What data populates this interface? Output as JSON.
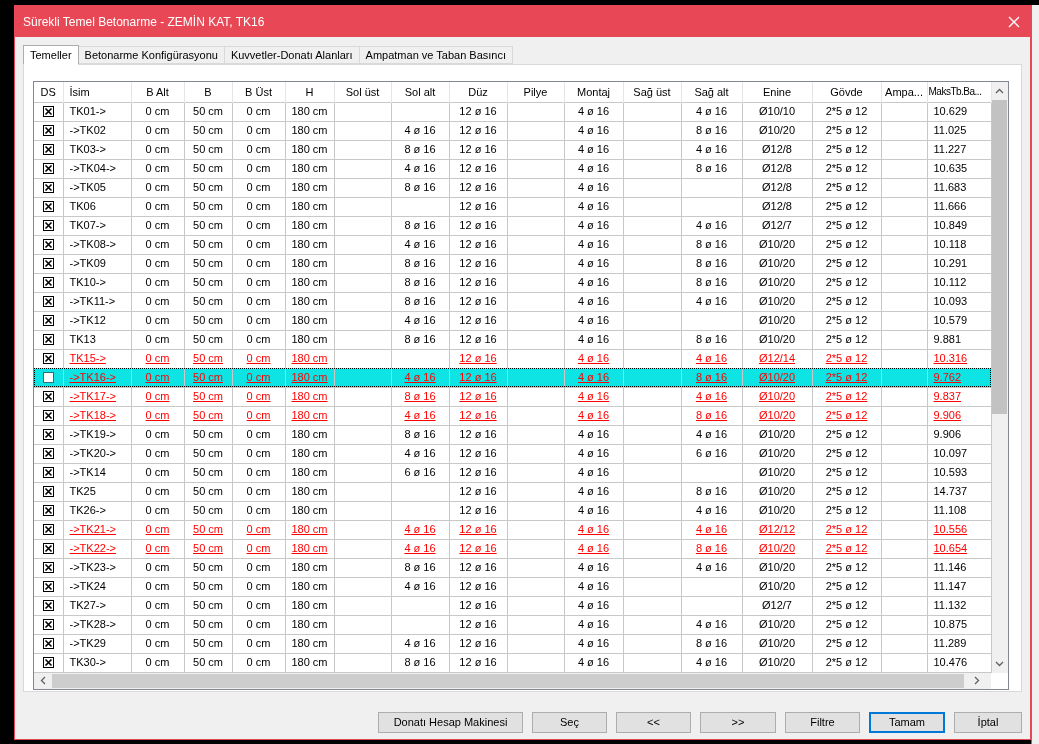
{
  "window": {
    "title": "Sürekli Temel Betonarme - ZEMİN KAT, TK16"
  },
  "tabs": [
    {
      "label": "Temeller",
      "selected": true
    },
    {
      "label": "Betonarme Konfigürasyonu",
      "selected": false
    },
    {
      "label": "Kuvvetler-Donatı Alanları",
      "selected": false
    },
    {
      "label": "Ampatman ve Taban Basıncı",
      "selected": false
    }
  ],
  "table": {
    "checkbox_column": "DS",
    "columns": [
      "İsim",
      "B Alt",
      "B",
      "B Üst",
      "H",
      "Sol üst",
      "Sol alt",
      "Düz",
      "Pilye",
      "Montaj",
      "Sağ üst",
      "Sağ alt",
      "Enine",
      "Gövde",
      "Ampa...",
      "MaksTb.Ba..."
    ],
    "rows": [
      {
        "checked": true,
        "flagged": false,
        "selected": false,
        "cells": [
          "TK01->",
          "0 cm",
          "50 cm",
          "0 cm",
          "180 cm",
          null,
          null,
          "12 ø 16",
          null,
          "4 ø 16",
          null,
          "4 ø 16",
          "Ø10/10",
          "2*5 ø 12",
          null,
          "10.629"
        ]
      },
      {
        "checked": true,
        "flagged": false,
        "selected": false,
        "cells": [
          "->TK02",
          "0 cm",
          "50 cm",
          "0 cm",
          "180 cm",
          null,
          "4 ø 16",
          "12 ø 16",
          null,
          "4 ø 16",
          null,
          "8 ø 16",
          "Ø10/20",
          "2*5 ø 12",
          null,
          "11.025"
        ]
      },
      {
        "checked": true,
        "flagged": false,
        "selected": false,
        "cells": [
          "TK03->",
          "0 cm",
          "50 cm",
          "0 cm",
          "180 cm",
          null,
          "8 ø 16",
          "12 ø 16",
          null,
          "4 ø 16",
          null,
          "4 ø 16",
          "Ø12/8",
          "2*5 ø 12",
          null,
          "11.227"
        ]
      },
      {
        "checked": true,
        "flagged": false,
        "selected": false,
        "cells": [
          "->TK04->",
          "0 cm",
          "50 cm",
          "0 cm",
          "180 cm",
          null,
          "4 ø 16",
          "12 ø 16",
          null,
          "4 ø 16",
          null,
          "8 ø 16",
          "Ø12/8",
          "2*5 ø 12",
          null,
          "10.635"
        ]
      },
      {
        "checked": true,
        "flagged": false,
        "selected": false,
        "cells": [
          "->TK05",
          "0 cm",
          "50 cm",
          "0 cm",
          "180 cm",
          null,
          "8 ø 16",
          "12 ø 16",
          null,
          "4 ø 16",
          null,
          null,
          "Ø12/8",
          "2*5 ø 12",
          null,
          "11.683"
        ]
      },
      {
        "checked": true,
        "flagged": false,
        "selected": false,
        "cells": [
          "TK06",
          "0 cm",
          "50 cm",
          "0 cm",
          "180 cm",
          null,
          null,
          "12 ø 16",
          null,
          "4 ø 16",
          null,
          null,
          "Ø12/8",
          "2*5 ø 12",
          null,
          "11.666"
        ]
      },
      {
        "checked": true,
        "flagged": false,
        "selected": false,
        "cells": [
          "TK07->",
          "0 cm",
          "50 cm",
          "0 cm",
          "180 cm",
          null,
          "8 ø 16",
          "12 ø 16",
          null,
          "4 ø 16",
          null,
          "4 ø 16",
          "Ø12/7",
          "2*5 ø 12",
          null,
          "10.849"
        ]
      },
      {
        "checked": true,
        "flagged": false,
        "selected": false,
        "cells": [
          "->TK08->",
          "0 cm",
          "50 cm",
          "0 cm",
          "180 cm",
          null,
          "4 ø 16",
          "12 ø 16",
          null,
          "4 ø 16",
          null,
          "8 ø 16",
          "Ø10/20",
          "2*5 ø 12",
          null,
          "10.118"
        ]
      },
      {
        "checked": true,
        "flagged": false,
        "selected": false,
        "cells": [
          "->TK09",
          "0 cm",
          "50 cm",
          "0 cm",
          "180 cm",
          null,
          "8 ø 16",
          "12 ø 16",
          null,
          "4 ø 16",
          null,
          "8 ø 16",
          "Ø10/20",
          "2*5 ø 12",
          null,
          "10.291"
        ]
      },
      {
        "checked": true,
        "flagged": false,
        "selected": false,
        "cells": [
          "TK10->",
          "0 cm",
          "50 cm",
          "0 cm",
          "180 cm",
          null,
          "8 ø 16",
          "12 ø 16",
          null,
          "4 ø 16",
          null,
          "8 ø 16",
          "Ø10/20",
          "2*5 ø 12",
          null,
          "10.112"
        ]
      },
      {
        "checked": true,
        "flagged": false,
        "selected": false,
        "cells": [
          "->TK11->",
          "0 cm",
          "50 cm",
          "0 cm",
          "180 cm",
          null,
          "8 ø 16",
          "12 ø 16",
          null,
          "4 ø 16",
          null,
          "4 ø 16",
          "Ø10/20",
          "2*5 ø 12",
          null,
          "10.093"
        ]
      },
      {
        "checked": true,
        "flagged": false,
        "selected": false,
        "cells": [
          "->TK12",
          "0 cm",
          "50 cm",
          "0 cm",
          "180 cm",
          null,
          "4 ø 16",
          "12 ø 16",
          null,
          "4 ø 16",
          null,
          null,
          "Ø10/20",
          "2*5 ø 12",
          null,
          "10.579"
        ]
      },
      {
        "checked": true,
        "flagged": false,
        "selected": false,
        "cells": [
          "TK13",
          "0 cm",
          "50 cm",
          "0 cm",
          "180 cm",
          null,
          "8 ø 16",
          "12 ø 16",
          null,
          "4 ø 16",
          null,
          "8 ø 16",
          "Ø10/20",
          "2*5 ø 12",
          null,
          "9.881"
        ]
      },
      {
        "checked": true,
        "flagged": true,
        "selected": false,
        "cells": [
          "TK15->",
          "0 cm",
          "50 cm",
          "0 cm",
          "180 cm",
          null,
          null,
          "12 ø 16",
          null,
          "4 ø 16",
          null,
          "4 ø 16",
          "Ø12/14",
          "2*5 ø 12",
          null,
          "10.316"
        ]
      },
      {
        "checked": false,
        "flagged": true,
        "selected": true,
        "cells": [
          "->TK16->",
          "0 cm",
          "50 cm",
          "0 cm",
          "180 cm",
          null,
          "4 ø 16",
          "12 ø 16",
          null,
          "4 ø 16",
          null,
          "8 ø 16",
          "Ø10/20",
          "2*5 ø 12",
          null,
          "9.762"
        ]
      },
      {
        "checked": true,
        "flagged": true,
        "selected": false,
        "cells": [
          "->TK17->",
          "0 cm",
          "50 cm",
          "0 cm",
          "180 cm",
          null,
          "8 ø 16",
          "12 ø 16",
          null,
          "4 ø 16",
          null,
          "4 ø 16",
          "Ø10/20",
          "2*5 ø 12",
          null,
          "9.837"
        ]
      },
      {
        "checked": true,
        "flagged": true,
        "selected": false,
        "cells": [
          "->TK18->",
          "0 cm",
          "50 cm",
          "0 cm",
          "180 cm",
          null,
          "4 ø 16",
          "12 ø 16",
          null,
          "4 ø 16",
          null,
          "8 ø 16",
          "Ø10/20",
          "2*5 ø 12",
          null,
          "9.906"
        ]
      },
      {
        "checked": true,
        "flagged": false,
        "selected": false,
        "cells": [
          "->TK19->",
          "0 cm",
          "50 cm",
          "0 cm",
          "180 cm",
          null,
          "8 ø 16",
          "12 ø 16",
          null,
          "4 ø 16",
          null,
          "4 ø 16",
          "Ø10/20",
          "2*5 ø 12",
          null,
          "9.906"
        ]
      },
      {
        "checked": true,
        "flagged": false,
        "selected": false,
        "cells": [
          "->TK20->",
          "0 cm",
          "50 cm",
          "0 cm",
          "180 cm",
          null,
          "4 ø 16",
          "12 ø 16",
          null,
          "4 ø 16",
          null,
          "6 ø 16",
          "Ø10/20",
          "2*5 ø 12",
          null,
          "10.097"
        ]
      },
      {
        "checked": true,
        "flagged": false,
        "selected": false,
        "cells": [
          "->TK14",
          "0 cm",
          "50 cm",
          "0 cm",
          "180 cm",
          null,
          "6 ø 16",
          "12 ø 16",
          null,
          "4 ø 16",
          null,
          null,
          "Ø10/20",
          "2*5 ø 12",
          null,
          "10.593"
        ]
      },
      {
        "checked": true,
        "flagged": false,
        "selected": false,
        "cells": [
          "TK25",
          "0 cm",
          "50 cm",
          "0 cm",
          "180 cm",
          null,
          null,
          "12 ø 16",
          null,
          "4 ø 16",
          null,
          "8 ø 16",
          "Ø10/20",
          "2*5 ø 12",
          null,
          "14.737"
        ]
      },
      {
        "checked": true,
        "flagged": false,
        "selected": false,
        "cells": [
          "TK26->",
          "0 cm",
          "50 cm",
          "0 cm",
          "180 cm",
          null,
          null,
          "12 ø 16",
          null,
          "4 ø 16",
          null,
          "4 ø 16",
          "Ø10/20",
          "2*5 ø 12",
          null,
          "11.108"
        ]
      },
      {
        "checked": true,
        "flagged": true,
        "selected": false,
        "cells": [
          "->TK21->",
          "0 cm",
          "50 cm",
          "0 cm",
          "180 cm",
          null,
          "4 ø 16",
          "12 ø 16",
          null,
          "4 ø 16",
          null,
          "4 ø 16",
          "Ø12/12",
          "2*5 ø 12",
          null,
          "10.556"
        ]
      },
      {
        "checked": true,
        "flagged": true,
        "selected": false,
        "cells": [
          "->TK22->",
          "0 cm",
          "50 cm",
          "0 cm",
          "180 cm",
          null,
          "4 ø 16",
          "12 ø 16",
          null,
          "4 ø 16",
          null,
          "8 ø 16",
          "Ø10/20",
          "2*5 ø 12",
          null,
          "10.654"
        ]
      },
      {
        "checked": true,
        "flagged": false,
        "selected": false,
        "cells": [
          "->TK23->",
          "0 cm",
          "50 cm",
          "0 cm",
          "180 cm",
          null,
          "8 ø 16",
          "12 ø 16",
          null,
          "4 ø 16",
          null,
          "4 ø 16",
          "Ø10/20",
          "2*5 ø 12",
          null,
          "11.146"
        ]
      },
      {
        "checked": true,
        "flagged": false,
        "selected": false,
        "cells": [
          "->TK24",
          "0 cm",
          "50 cm",
          "0 cm",
          "180 cm",
          null,
          "4 ø 16",
          "12 ø 16",
          null,
          "4 ø 16",
          null,
          null,
          "Ø10/20",
          "2*5 ø 12",
          null,
          "11.147"
        ]
      },
      {
        "checked": true,
        "flagged": false,
        "selected": false,
        "cells": [
          "TK27->",
          "0 cm",
          "50 cm",
          "0 cm",
          "180 cm",
          null,
          null,
          "12 ø 16",
          null,
          "4 ø 16",
          null,
          null,
          "Ø12/7",
          "2*5 ø 12",
          null,
          "11.132"
        ]
      },
      {
        "checked": true,
        "flagged": false,
        "selected": false,
        "cells": [
          "->TK28->",
          "0 cm",
          "50 cm",
          "0 cm",
          "180 cm",
          null,
          null,
          "12 ø 16",
          null,
          "4 ø 16",
          null,
          "4 ø 16",
          "Ø10/20",
          "2*5 ø 12",
          null,
          "10.875"
        ]
      },
      {
        "checked": true,
        "flagged": false,
        "selected": false,
        "cells": [
          "->TK29",
          "0 cm",
          "50 cm",
          "0 cm",
          "180 cm",
          null,
          "4 ø 16",
          "12 ø 16",
          null,
          "4 ø 16",
          null,
          "8 ø 16",
          "Ø10/20",
          "2*5 ø 12",
          null,
          "11.289"
        ]
      },
      {
        "checked": true,
        "flagged": false,
        "selected": false,
        "cells": [
          "TK30->",
          "0 cm",
          "50 cm",
          "0 cm",
          "180 cm",
          null,
          "8 ø 16",
          "12 ø 16",
          null,
          "4 ø 16",
          null,
          "4 ø 16",
          "Ø10/20",
          "2*5 ø 12",
          null,
          "10.476"
        ]
      }
    ]
  },
  "buttons": [
    {
      "label": "Donatı Hesap Makinesi",
      "default": false
    },
    {
      "label": "Seç",
      "default": false
    },
    {
      "label": "<<",
      "default": false
    },
    {
      "label": ">>",
      "default": false
    },
    {
      "label": "Filtre",
      "default": false
    },
    {
      "label": "Tamam",
      "default": true
    },
    {
      "label": "İptal",
      "default": false
    }
  ]
}
